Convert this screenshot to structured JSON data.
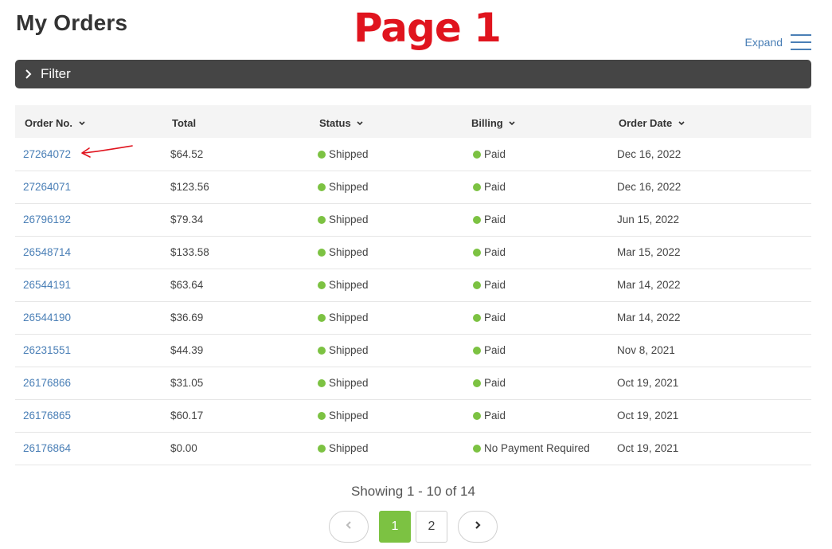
{
  "header": {
    "title": "My Orders",
    "annotation": "Page 1",
    "expand_label": "Expand"
  },
  "filter": {
    "label": "Filter"
  },
  "table": {
    "columns": [
      "Order No.",
      "Total",
      "Status",
      "Billing",
      "Order Date"
    ],
    "rows": [
      {
        "order": "27264072",
        "total": "$64.52",
        "status": "Shipped",
        "billing": "Paid",
        "date": "Dec 16, 2022"
      },
      {
        "order": "27264071",
        "total": "$123.56",
        "status": "Shipped",
        "billing": "Paid",
        "date": "Dec 16, 2022"
      },
      {
        "order": "26796192",
        "total": "$79.34",
        "status": "Shipped",
        "billing": "Paid",
        "date": "Jun 15, 2022"
      },
      {
        "order": "26548714",
        "total": "$133.58",
        "status": "Shipped",
        "billing": "Paid",
        "date": "Mar 15, 2022"
      },
      {
        "order": "26544191",
        "total": "$63.64",
        "status": "Shipped",
        "billing": "Paid",
        "date": "Mar 14, 2022"
      },
      {
        "order": "26544190",
        "total": "$36.69",
        "status": "Shipped",
        "billing": "Paid",
        "date": "Mar 14, 2022"
      },
      {
        "order": "26231551",
        "total": "$44.39",
        "status": "Shipped",
        "billing": "Paid",
        "date": "Nov 8, 2021"
      },
      {
        "order": "26176866",
        "total": "$31.05",
        "status": "Shipped",
        "billing": "Paid",
        "date": "Oct 19, 2021"
      },
      {
        "order": "26176865",
        "total": "$60.17",
        "status": "Shipped",
        "billing": "Paid",
        "date": "Oct 19, 2021"
      },
      {
        "order": "26176864",
        "total": "$0.00",
        "status": "Shipped",
        "billing": "No Payment Required",
        "date": "Oct 19, 2021"
      }
    ]
  },
  "pagination": {
    "showing": "Showing 1 - 10 of 14",
    "pages": [
      "1",
      "2"
    ],
    "current": "1"
  },
  "colors": {
    "accent_green": "#7cc242",
    "link_blue": "#4a7fb6",
    "annotation_red": "#e0141e",
    "filter_bar": "#454545"
  },
  "icons": {
    "filter": "chevron-right-icon",
    "expand": "hamburger-menu-icon",
    "sort": "chevron-down-icon",
    "prev": "chevron-left-icon",
    "next": "chevron-right-icon",
    "annotation": "hand-drawn-arrow-icon"
  }
}
